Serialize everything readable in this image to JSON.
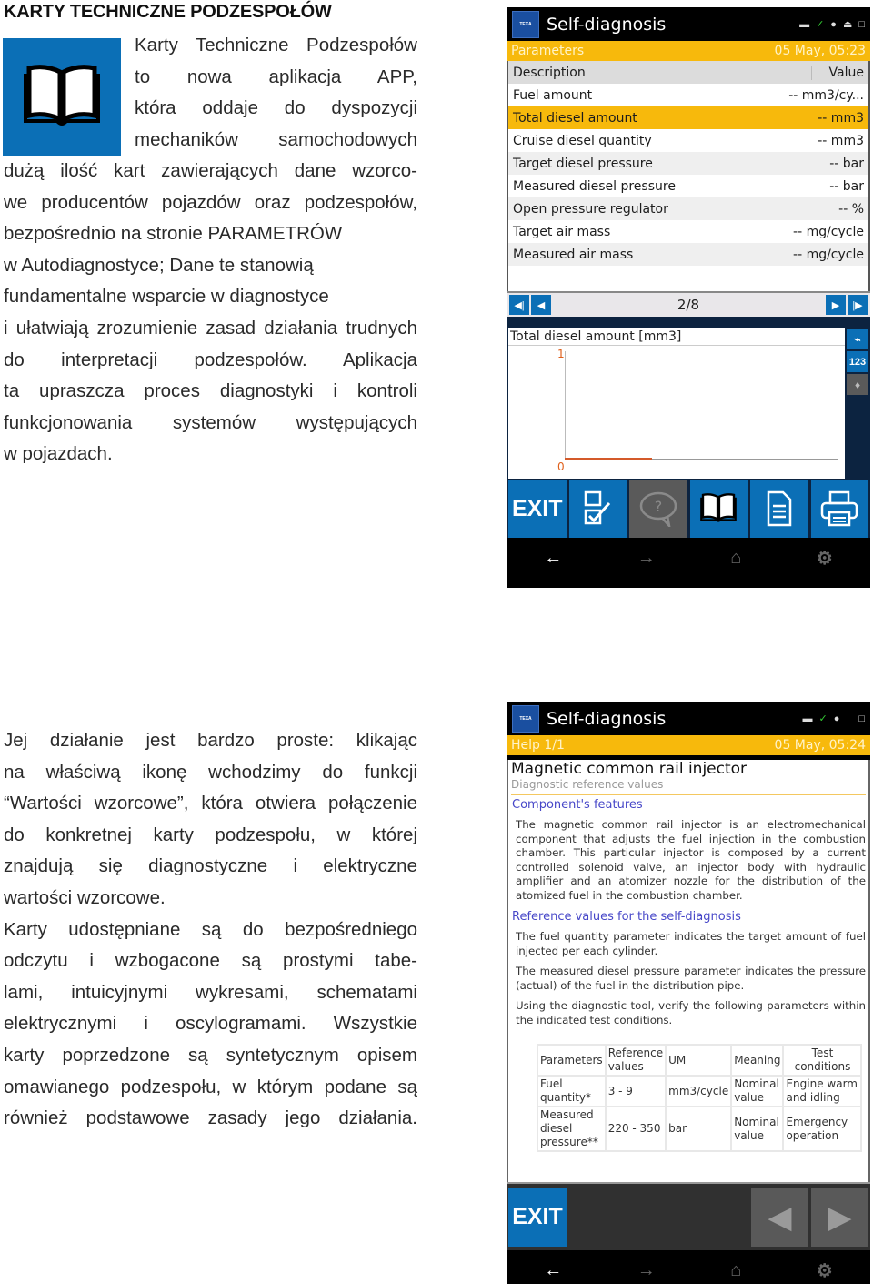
{
  "article": {
    "heading": "KARTY TECHNICZNE PODZESPOŁÓW",
    "intro_lines_beside_icon": [
      "Karty Techniczne Podzespołów",
      "to nowa aplikacja APP,",
      "która oddaje do dyspozycji",
      "mechaników samochodowych"
    ],
    "intro_lines_below_icon": [
      "dużą ilość kart zawierających dane wzorco-",
      "we producentów pojazdów oraz podzespołów,",
      "bezpośrednio na stronie PARAMETRÓW",
      "w Autodiagnostyce; Dane te stanowią",
      "fundamentalne wsparcie w diagnostyce",
      "i ułatwiają zrozumienie zasad działania trudnych",
      "do interpretacji podzespołów. Aplikacja",
      "ta upraszcza proces diagnostyki i kontroli",
      "funkcjonowania systemów występujących",
      "w pojazdach."
    ],
    "second_paragraph_lines": [
      "Jej działanie jest bardzo proste: klikając",
      "na właściwą ikonę wchodzimy do funkcji",
      "“Wartości wzorcowe”, która otwiera połączenie",
      "do konkretnej karty podzespołu, w której",
      "znajdują się diagnostyczne i elektryczne",
      "wartości wzorcowe.",
      "Karty udostępniane są do bezpośredniego",
      "odczytu i wzbogacone są prostymi tabe-",
      "lami, intuicyjnymi wykresami, schematami",
      "elektrycznymi i oscylogramami. Wszystkie",
      "karty poprzedzone są syntetycznym opisem",
      "omawianego podzespołu, w którym podane są",
      "również podstawowe zasady jego działania."
    ],
    "icon": "open-book-icon",
    "accent_color": "#0b6fb6"
  },
  "screen1": {
    "logo_text": "TEXA",
    "title": "Self-diagnosis",
    "status_icons": [
      "car-icon",
      "document-check-icon",
      "bluetooth-icon",
      "usb-icon",
      "battery-icon"
    ],
    "section": "Parameters",
    "datetime": "05 May, 05:23",
    "table_header": {
      "description": "Description",
      "value": "Value"
    },
    "rows": [
      {
        "description": "Fuel amount",
        "value": "-- mm3/cy..."
      },
      {
        "description": "Total diesel amount",
        "value": "-- mm3",
        "selected": true
      },
      {
        "description": "Cruise diesel quantity",
        "value": "-- mm3"
      },
      {
        "description": "Target diesel pressure",
        "value": "-- bar"
      },
      {
        "description": "Measured diesel pressure",
        "value": "-- bar"
      },
      {
        "description": "Open pressure regulator",
        "value": "-- %"
      },
      {
        "description": "Target air mass",
        "value": "-- mg/cycle"
      },
      {
        "description": "Measured air mass",
        "value": "-- mg/cycle"
      }
    ],
    "pager": {
      "current": 2,
      "total": 8,
      "label": "2/8"
    },
    "graph": {
      "title": "Total diesel amount [mm3]",
      "y_max_label": "1",
      "y_min_label": "0",
      "side_buttons": [
        "line-chart-icon",
        "numeric-view-icon",
        "eraser-icon"
      ]
    },
    "toolbar": {
      "exit_label": "EXIT",
      "buttons": [
        "checklist-icon",
        "help-bubble-icon",
        "open-book-icon",
        "document-icon",
        "printer-icon"
      ]
    },
    "nav": [
      "back-arrow-icon",
      "forward-arrow-icon",
      "home-icon",
      "settings-gear-icon"
    ],
    "colors": {
      "accent_yellow": "#f7b90c",
      "accent_blue": "#0b6fb6"
    }
  },
  "screen2": {
    "logo_text": "TEXA",
    "title": "Self-diagnosis",
    "section": "Help 1/1",
    "datetime": "05 May, 05:24",
    "card_title": "Magnetic common rail injector",
    "card_subtitle": "Diagnostic reference values",
    "section1_title": "Component's features",
    "section1_text": "The magnetic common rail injector is an electromechanical component that adjusts the fuel injection in the combustion chamber. This particular injector is composed by a current controlled solenoid valve, an injector body with hydraulic amplifier and an atomizer nozzle for the distribution of the atomized fuel in the combustion chamber.",
    "section2_title": "Reference values for the self-diagnosis",
    "section2_paragraphs": [
      "The fuel quantity parameter indicates the target amount of fuel injected per each cylinder.",
      "The measured diesel pressure parameter indicates the pressure (actual) of the fuel in the distribution pipe.",
      "Using the diagnostic tool, verify the following parameters within the indicated test conditions."
    ],
    "ref_table": {
      "headers": [
        "Parameters",
        "Reference values",
        "UM",
        "Meaning",
        "Test conditions"
      ],
      "rows": [
        [
          "Fuel quantity*",
          "3 - 9",
          "mm3/cycle",
          "Nominal value",
          "Engine warm and idling"
        ],
        [
          "Measured diesel pressure**",
          "220 - 350",
          "bar",
          "Nominal value",
          "Emergency operation"
        ]
      ]
    },
    "footer": {
      "exit_label": "EXIT",
      "prev": "previous-page-icon",
      "next": "next-page-icon"
    },
    "nav": [
      "back-arrow-icon",
      "forward-arrow-icon",
      "home-icon",
      "settings-gear-icon"
    ]
  }
}
